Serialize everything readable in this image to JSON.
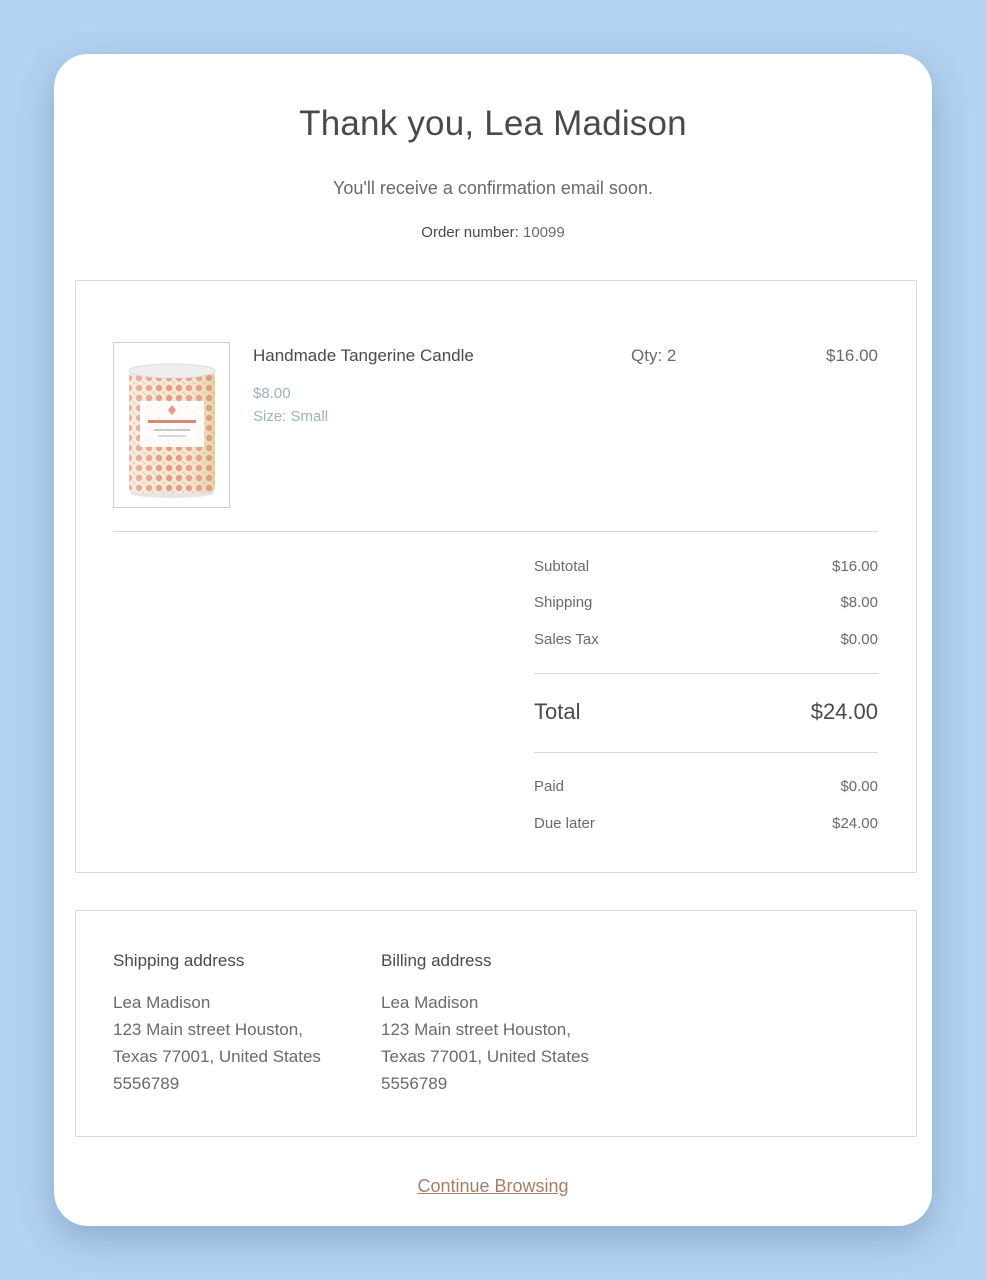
{
  "header": {
    "title": "Thank you, Lea Madison",
    "subtitle": "You'll receive a confirmation email soon.",
    "order_label": "Order number:",
    "order_number": "10099"
  },
  "item": {
    "name": "Handmade Tangerine Candle",
    "unit_price": "$8.00",
    "size": "Size: Small",
    "qty": "Qty: 2",
    "line_total": "$16.00",
    "image_icon": "candle-product-image"
  },
  "summary": {
    "subtotal_label": "Subtotal",
    "subtotal": "$16.00",
    "shipping_label": "Shipping",
    "shipping": "$8.00",
    "tax_label": "Sales Tax",
    "tax": "$0.00",
    "total_label": "Total",
    "total": "$24.00",
    "paid_label": "Paid",
    "paid": "$0.00",
    "due_label": "Due later",
    "due": "$24.00"
  },
  "shipping_address": {
    "heading": "Shipping address",
    "lines": [
      "Lea Madison",
      "123 Main street Houston,",
      "Texas 77001, United States",
      "5556789"
    ]
  },
  "billing_address": {
    "heading": "Billing address",
    "lines": [
      "Lea Madison",
      "123 Main street Houston,",
      "Texas 77001, United States",
      "5556789"
    ]
  },
  "footer": {
    "continue_label": "Continue Browsing"
  },
  "colors": {
    "background": "#b3d3f3",
    "link": "#a97d6a",
    "muted_price": "#9cb3b8"
  }
}
